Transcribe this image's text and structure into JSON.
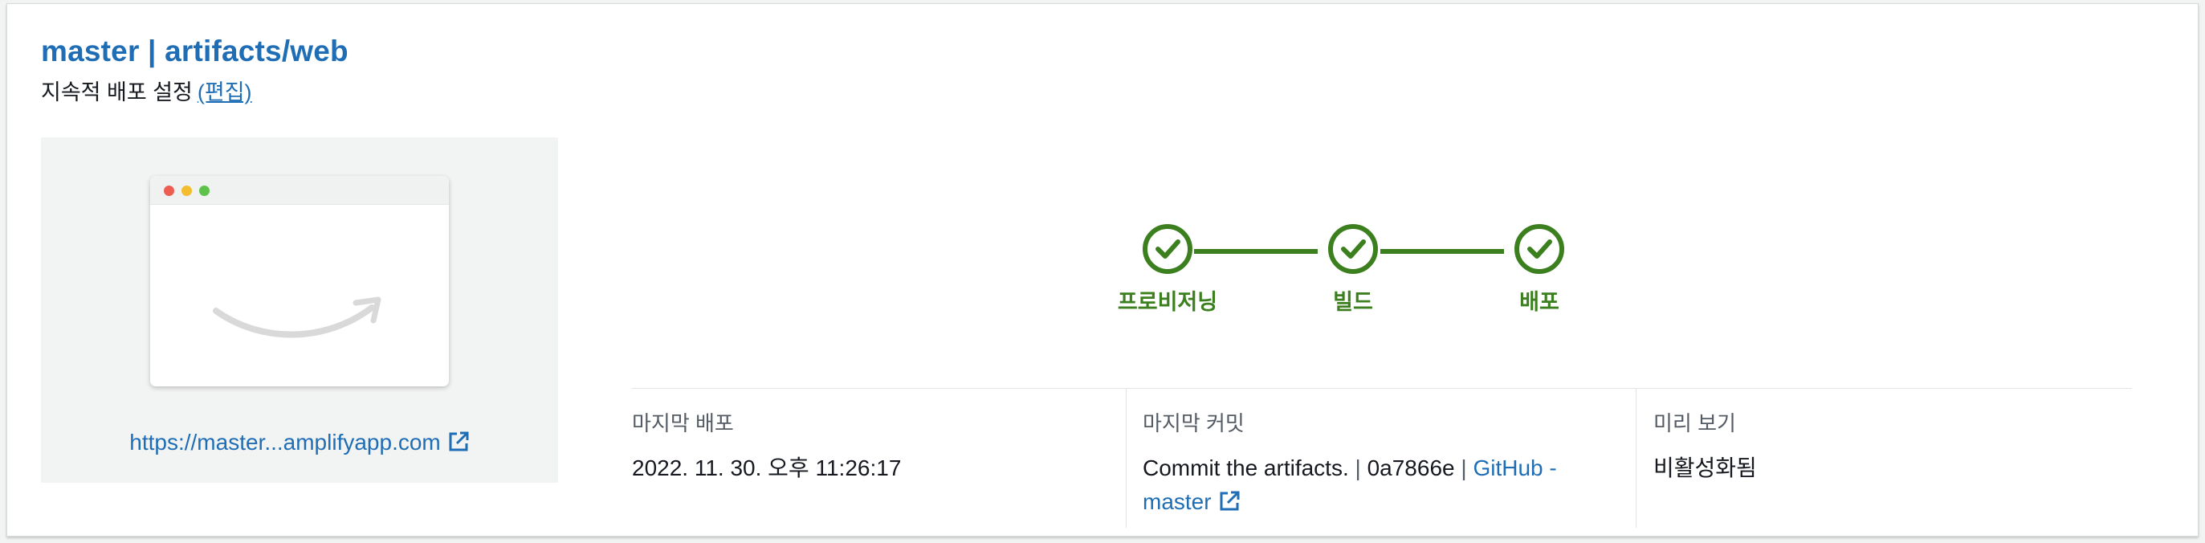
{
  "header": {
    "title": "master | artifacts/web",
    "subtitle": "지속적 배포 설정",
    "edit_link": "(편집)"
  },
  "preview": {
    "url_label": "https://master...amplifyapp.com",
    "icons": [
      "external-link-icon",
      "amazon-smile-logo"
    ]
  },
  "pipeline": {
    "steps": [
      {
        "label": "프로비저닝",
        "status": "complete",
        "icon": "check-circle-icon"
      },
      {
        "label": "빌드",
        "status": "complete",
        "icon": "check-circle-icon"
      },
      {
        "label": "배포",
        "status": "complete",
        "icon": "check-circle-icon"
      }
    ],
    "color": "#3b7f1e"
  },
  "details": {
    "last_deploy": {
      "label": "마지막 배포",
      "value": "2022. 11. 30. 오후 11:26:17"
    },
    "last_commit": {
      "label": "마지막 커밋",
      "message": "Commit the artifacts.",
      "separator": "|",
      "hash": "0a7866e",
      "repo_link": "GitHub - master"
    },
    "preview": {
      "label": "미리 보기",
      "value": "비활성화됨"
    }
  },
  "colors": {
    "link": "#1f6eb5",
    "success": "#3b7f1e"
  }
}
